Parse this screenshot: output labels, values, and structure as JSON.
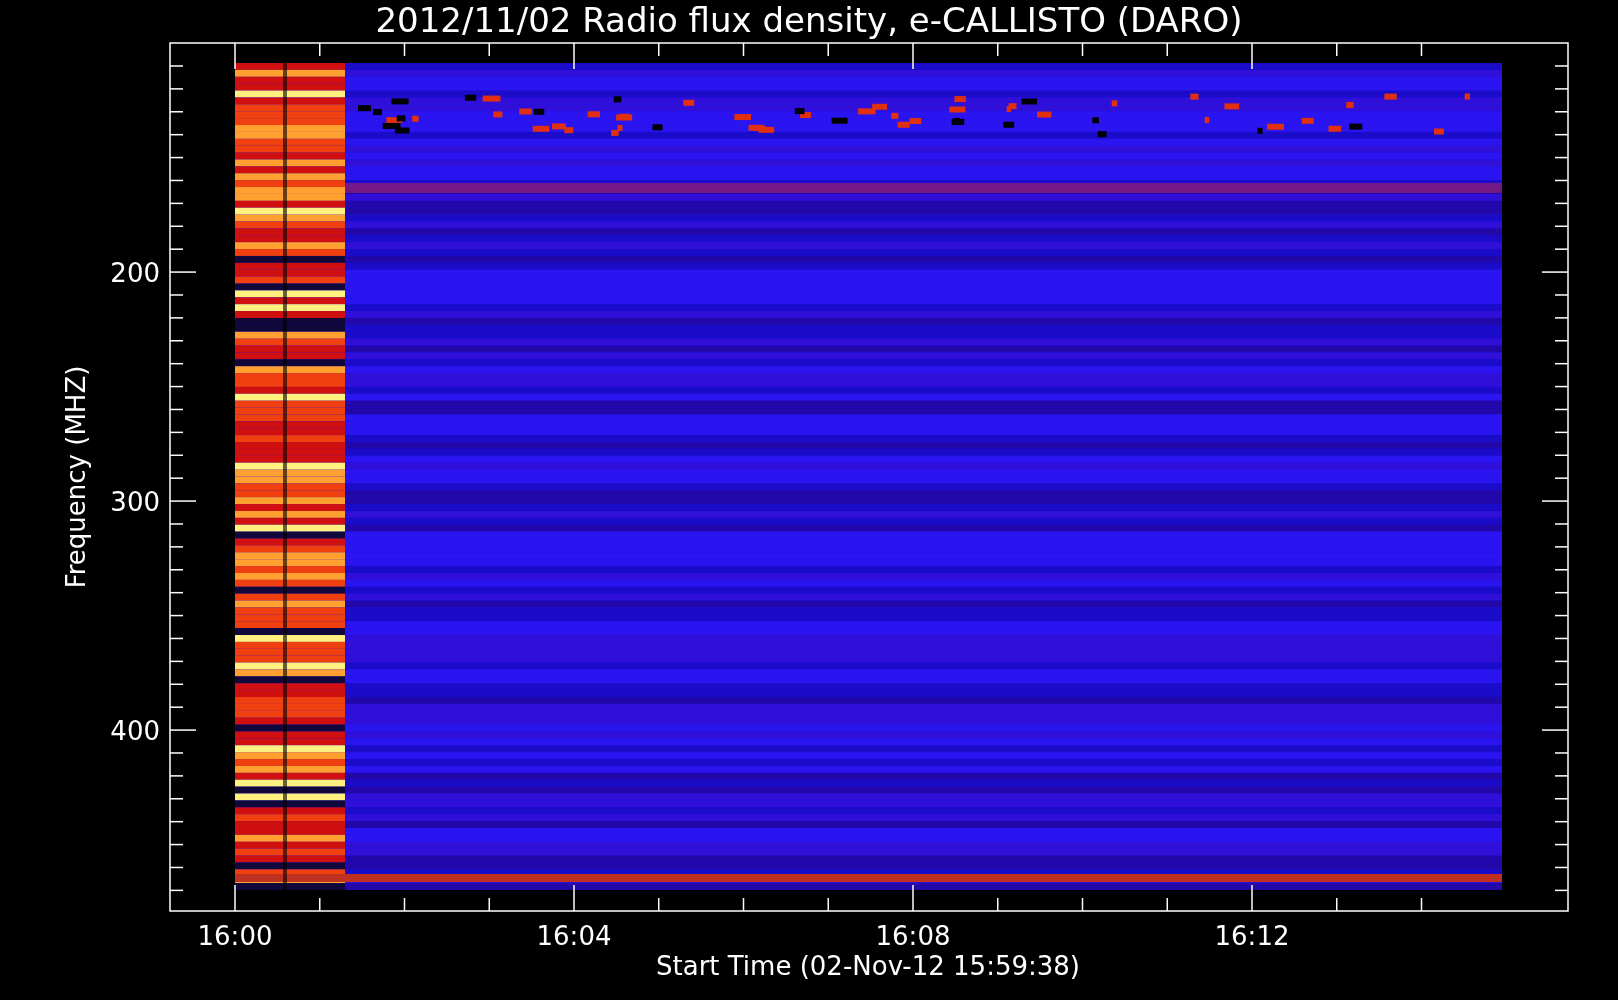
{
  "title": "2012/11/02  Radio flux density, e-CALLISTO (DARO)",
  "y_axis": {
    "label": "Frequency (MHZ)",
    "ticks": [
      {
        "label": "200"
      },
      {
        "label": "300"
      },
      {
        "label": "400"
      }
    ]
  },
  "x_axis": {
    "label": "Start Time (02-Nov-12 15:59:38)",
    "ticks": [
      {
        "label": "16:00"
      },
      {
        "label": "16:04"
      },
      {
        "label": "16:08"
      },
      {
        "label": "16:12"
      }
    ]
  }
}
